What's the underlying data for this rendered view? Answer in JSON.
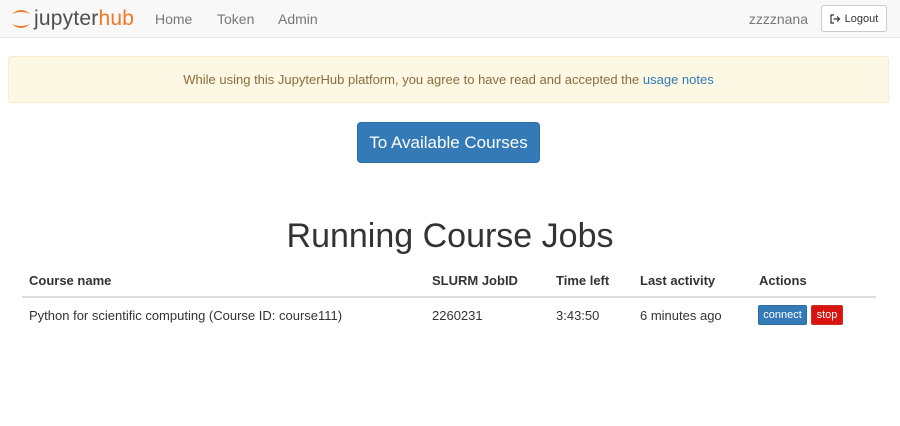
{
  "navbar": {
    "logo": {
      "text_main": "jupyter",
      "text_accent": "hub"
    },
    "links": [
      "Home",
      "Token",
      "Admin"
    ],
    "user": "zzzznana",
    "logout_label": "Logout"
  },
  "alert": {
    "text": "While using this JupyterHub platform, you agree to have read and accepted the ",
    "link_text": "usage notes"
  },
  "courses_button": "To Available Courses",
  "section_title": "Running Course Jobs",
  "table": {
    "headers": [
      "Course name",
      "SLURM JobID",
      "Time left",
      "Last activity",
      "Actions"
    ],
    "rows": [
      {
        "course_name": "Python for scientific computing (Course ID: course111)",
        "job_id": "2260231",
        "time_left": "3:43:50",
        "last_activity": "6 minutes ago",
        "connect_label": "connect",
        "stop_label": "stop"
      }
    ]
  },
  "colors": {
    "primary": "#337ab7",
    "danger": "#d9130f",
    "brand_orange": "#f37726",
    "alert_bg": "#fcf8e3",
    "alert_text": "#8a6d3b"
  }
}
